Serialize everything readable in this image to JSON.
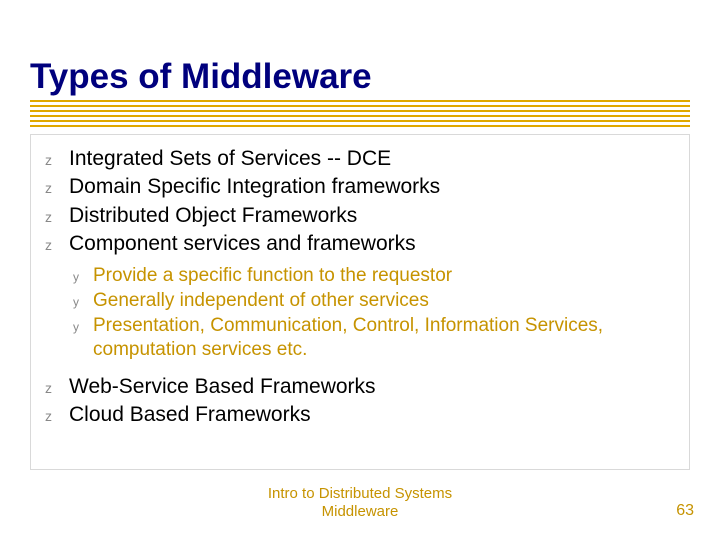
{
  "title": "Types of Middleware",
  "bullets": {
    "l1": [
      {
        "label": "Integrated Sets of Services -- DCE"
      },
      {
        "label": "Domain Specific Integration frameworks"
      },
      {
        "label": "Distributed Object Frameworks"
      },
      {
        "label": "Component services and frameworks"
      },
      {
        "label": "Web-Service Based Frameworks"
      },
      {
        "label": "Cloud Based Frameworks"
      }
    ],
    "l2_after_index": 3,
    "l2": [
      {
        "label": "Provide a specific function to the requestor"
      },
      {
        "label": "Generally independent of other services"
      },
      {
        "label": "Presentation, Communication, Control, Information Services, computation services etc."
      }
    ]
  },
  "footer": {
    "line1": "Intro to Distributed Systems",
    "line2": "Middleware"
  },
  "page_number": "63",
  "bullet_glyph_l1": "z",
  "bullet_glyph_l2": "y"
}
